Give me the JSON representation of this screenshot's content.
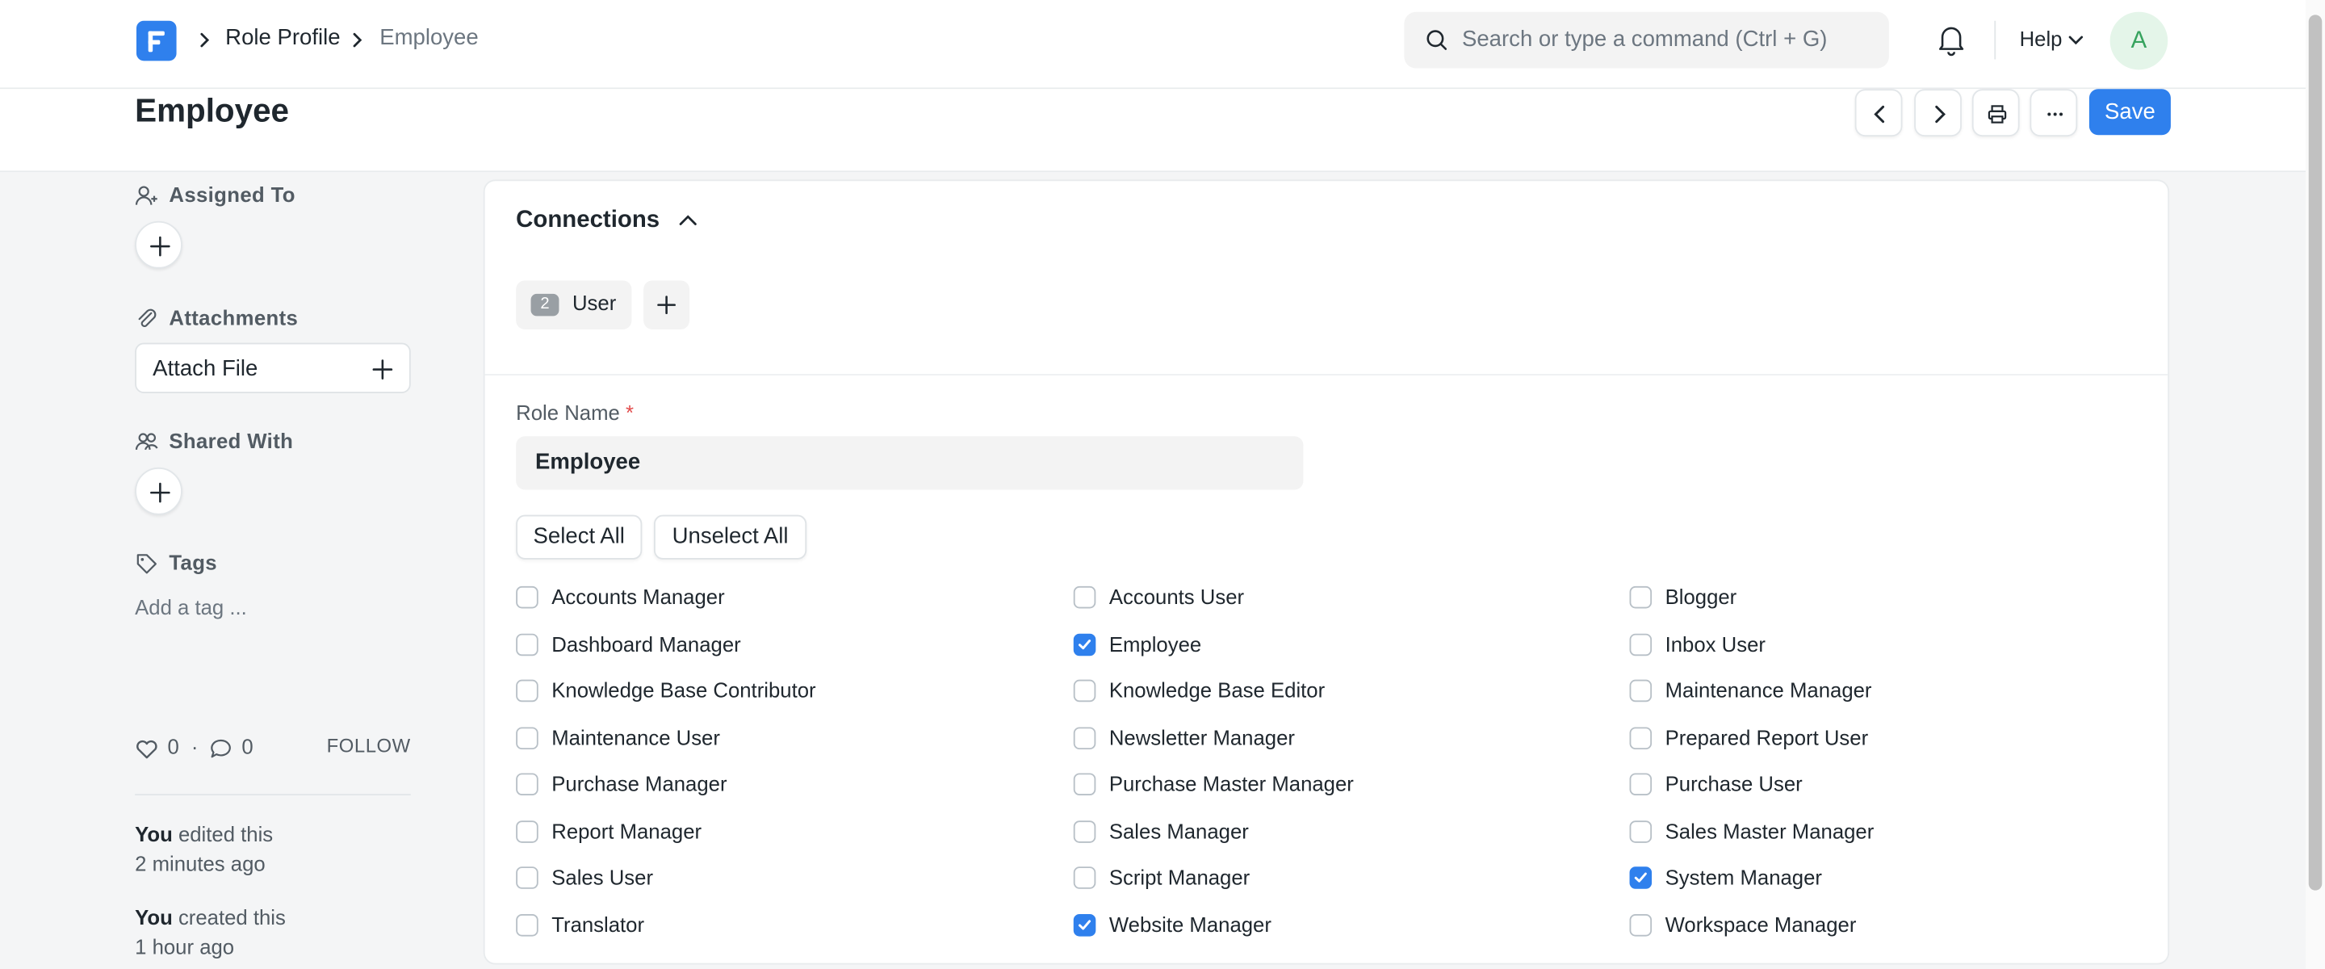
{
  "navbar": {
    "breadcrumbs": [
      "Role Profile",
      "Employee"
    ],
    "search_placeholder": "Search or type a command (Ctrl + G)",
    "help_label": "Help",
    "avatar_initial": "A"
  },
  "page": {
    "title": "Employee",
    "save_label": "Save"
  },
  "sidebar": {
    "assigned_to": "Assigned To",
    "attachments": "Attachments",
    "attach_file": "Attach File",
    "shared_with": "Shared With",
    "tags": "Tags",
    "add_tag": "Add a tag ...",
    "likes": "0",
    "comments": "0",
    "follow": "FOLLOW",
    "activity": [
      {
        "who": "You",
        "what": " edited this",
        "when": "2 minutes ago"
      },
      {
        "who": "You",
        "what": " created this",
        "when": "1 hour ago"
      }
    ]
  },
  "connections": {
    "title": "Connections",
    "items": [
      {
        "count": "2",
        "label": "User"
      }
    ]
  },
  "form": {
    "role_name_label": "Role Name",
    "required_mark": "*",
    "role_name_value": "Employee",
    "select_all": "Select All",
    "unselect_all": "Unselect All",
    "roles": [
      {
        "label": "Accounts Manager",
        "checked": false
      },
      {
        "label": "Accounts User",
        "checked": false
      },
      {
        "label": "Blogger",
        "checked": false
      },
      {
        "label": "Dashboard Manager",
        "checked": false
      },
      {
        "label": "Employee",
        "checked": true
      },
      {
        "label": "Inbox User",
        "checked": false
      },
      {
        "label": "Knowledge Base Contributor",
        "checked": false
      },
      {
        "label": "Knowledge Base Editor",
        "checked": false
      },
      {
        "label": "Maintenance Manager",
        "checked": false
      },
      {
        "label": "Maintenance User",
        "checked": false
      },
      {
        "label": "Newsletter Manager",
        "checked": false
      },
      {
        "label": "Prepared Report User",
        "checked": false
      },
      {
        "label": "Purchase Manager",
        "checked": false
      },
      {
        "label": "Purchase Master Manager",
        "checked": false
      },
      {
        "label": "Purchase User",
        "checked": false
      },
      {
        "label": "Report Manager",
        "checked": false
      },
      {
        "label": "Sales Manager",
        "checked": false
      },
      {
        "label": "Sales Master Manager",
        "checked": false
      },
      {
        "label": "Sales User",
        "checked": false
      },
      {
        "label": "Script Manager",
        "checked": false
      },
      {
        "label": "System Manager",
        "checked": true
      },
      {
        "label": "Translator",
        "checked": false
      },
      {
        "label": "Website Manager",
        "checked": true
      },
      {
        "label": "Workspace Manager",
        "checked": false
      }
    ]
  },
  "colors": {
    "primary": "#2f80ed",
    "avatar_bg": "#e4f5e9",
    "avatar_text": "#36a35e",
    "required": "#e24c4c"
  }
}
